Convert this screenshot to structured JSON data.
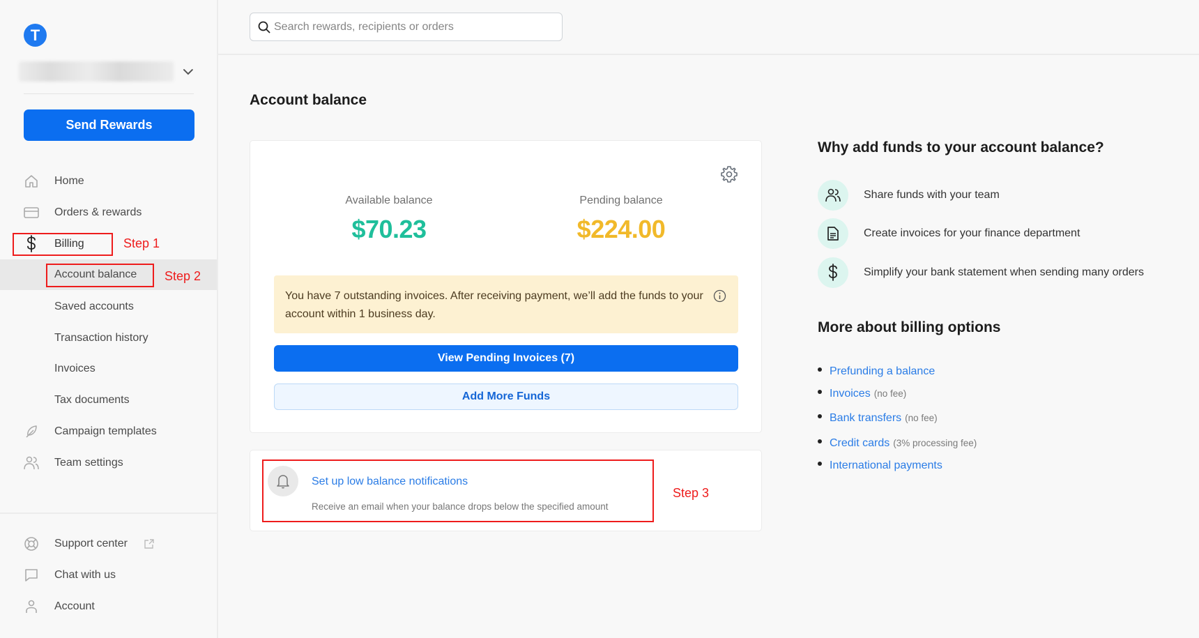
{
  "brand": {
    "logo_letter": "T",
    "accent": "#0b6ef0"
  },
  "sidebar": {
    "org_name": "(blurred)",
    "send_rewards_label": "Send Rewards",
    "nav": [
      {
        "label": "Home",
        "icon": "home-icon"
      },
      {
        "label": "Orders & rewards",
        "icon": "card-icon"
      },
      {
        "label": "Billing",
        "icon": "dollar-icon"
      },
      {
        "label": "Account balance",
        "active": true
      },
      {
        "label": "Saved accounts"
      },
      {
        "label": "Transaction history"
      },
      {
        "label": "Invoices"
      },
      {
        "label": "Tax documents"
      },
      {
        "label": "Campaign templates",
        "icon": "feather-icon"
      },
      {
        "label": "Team settings",
        "icon": "team-icon"
      }
    ],
    "footer": [
      {
        "label": "Support center",
        "icon": "lifebuoy-icon",
        "external": true
      },
      {
        "label": "Chat with us",
        "icon": "chat-icon"
      },
      {
        "label": "Account",
        "icon": "user-icon"
      }
    ]
  },
  "search": {
    "placeholder": "Search rewards, recipients or orders",
    "value": ""
  },
  "page": {
    "title": "Account balance"
  },
  "balance": {
    "available_label": "Available balance",
    "available_value": "$70.23",
    "available_color": "#1fbf9b",
    "pending_label": "Pending balance",
    "pending_value": "$224.00",
    "pending_color": "#f1b92a",
    "notice": "You have 7 outstanding invoices. After receiving payment, we’ll add the funds to your account within 1 business day.",
    "view_invoices_label": "View Pending Invoices (7)",
    "add_funds_label": "Add More Funds"
  },
  "notification": {
    "title": "Set up low balance notifications",
    "description": "Receive an email when your balance drops below the specified amount"
  },
  "right_panel": {
    "why_title": "Why add funds to your account balance?",
    "reasons": [
      {
        "icon": "team-icon",
        "text": "Share funds with your team"
      },
      {
        "icon": "document-icon",
        "text": "Create invoices for your finance department"
      },
      {
        "icon": "dollar-icon",
        "text": "Simplify your bank statement when sending many orders"
      }
    ],
    "more_title": "More about billing options",
    "links": [
      {
        "label": "Prefunding a balance",
        "note": ""
      },
      {
        "label": "Invoices",
        "note": "(no fee)"
      },
      {
        "label": "Bank transfers",
        "note": "(no fee)"
      },
      {
        "label": "Credit cards",
        "note": "(3% processing fee)"
      },
      {
        "label": "International payments",
        "note": ""
      }
    ]
  },
  "annotations": {
    "step1": "Step 1",
    "step2": "Step 2",
    "step3": "Step 3",
    "color": "#ee1c1c"
  }
}
